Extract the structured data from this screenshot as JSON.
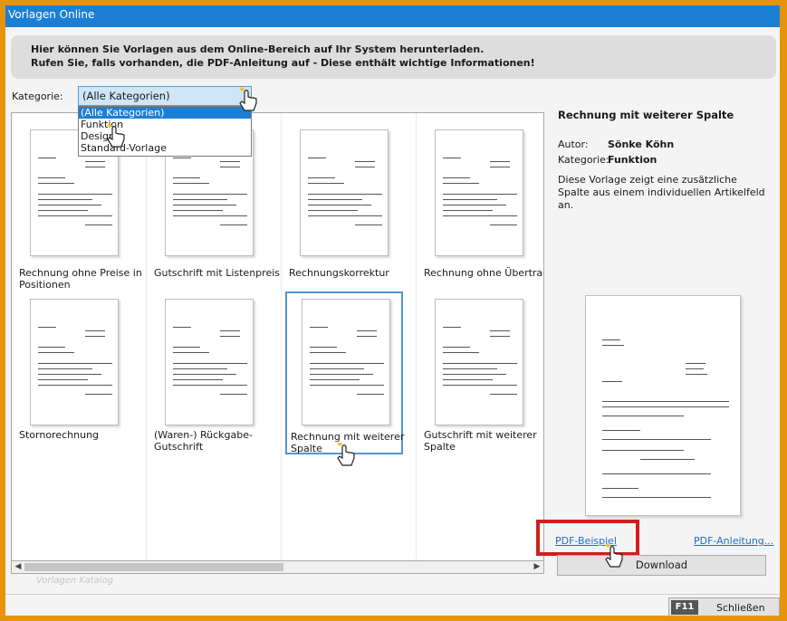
{
  "window": {
    "title": "Vorlagen Online"
  },
  "banner": {
    "line1": "Hier können Sie Vorlagen aus dem Online-Bereich auf Ihr System herunterladen.",
    "line2": "Rufen Sie, falls vorhanden, die PDF-Anleitung auf - Diese enthält wichtige Informationen!"
  },
  "category": {
    "label": "Kategorie:",
    "selected": "(Alle Kategorien)",
    "options": [
      "(Alle Kategorien)",
      "Funktion",
      "Design",
      "Standard-Vorlage"
    ]
  },
  "templates": [
    {
      "label": "Rechnung ohne Preise in Positionen"
    },
    {
      "label": "Gutschrift mit Listenpreis"
    },
    {
      "label": "Rechnungskorrektur"
    },
    {
      "label": "Rechnung ohne Übertrag"
    },
    {
      "label": "Stornorechnung"
    },
    {
      "label": "(Waren-) Rückgabe-Gutschrift"
    },
    {
      "label": "Rechnung mit weiterer Spalte"
    },
    {
      "label": "Gutschrift mit weiterer Spalte"
    }
  ],
  "catalog_label": "Vorlagen Katalog",
  "detail": {
    "title": "Rechnung mit weiterer Spalte",
    "author_key": "Autor:",
    "author": "Sönke Köhn",
    "category_key": "Kategorie:",
    "category": "Funktion",
    "description": "Diese Vorlage zeigt eine zusätzliche Spalte aus einem individuellen Artikelfeld an."
  },
  "links": {
    "pdf_example": "PDF-Beispiel",
    "pdf_manual": "PDF-Anleitung..."
  },
  "buttons": {
    "download": "Download",
    "close_key": "F11",
    "close": "Schließen"
  },
  "colors": {
    "accent": "#1c7fd6",
    "highlight": "#d21e1e",
    "frame": "#e8930c"
  }
}
